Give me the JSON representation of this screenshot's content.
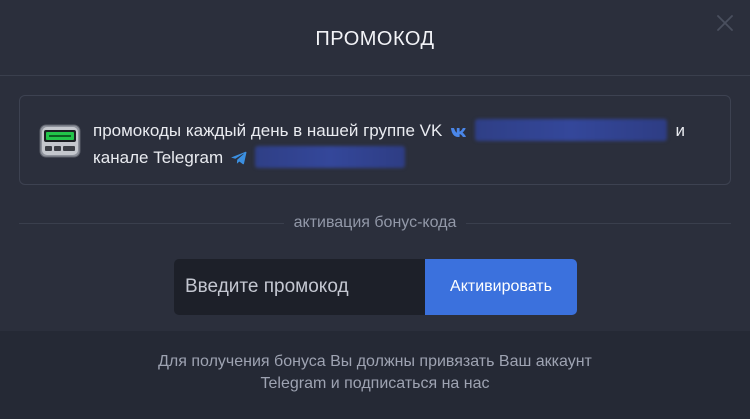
{
  "modal": {
    "title": "ПРОМОКОД"
  },
  "info": {
    "line1_prefix": "промокоды каждый день в нашей группе VK",
    "line1_suffix": "и",
    "line2_prefix": "канале Telegram",
    "icons": [
      "pager-icon",
      "vk-icon",
      "telegram-icon"
    ]
  },
  "divider": {
    "label": "активация бонус-кода"
  },
  "promo": {
    "placeholder": "Введите промокод",
    "value": "",
    "button_label": "Активировать"
  },
  "footer": {
    "text": "Для получения бонуса Вы должны привязать Ваш аккаунт Telegram и подписаться на нас"
  },
  "colors": {
    "background": "#2b2f3c",
    "footer_background": "#252935",
    "accent": "#3b71dd",
    "input_background": "#1d2029"
  }
}
